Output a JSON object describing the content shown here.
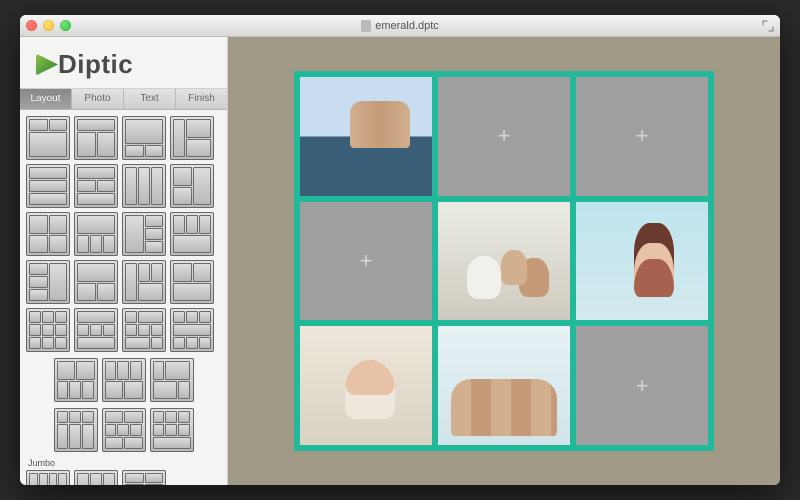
{
  "window": {
    "title": "emerald.dptc"
  },
  "app": {
    "name": "Diptic",
    "logo_letter": "D"
  },
  "tabs": [
    {
      "id": "layout",
      "label": "Layout",
      "active": true
    },
    {
      "id": "photo",
      "label": "Photo",
      "active": false
    },
    {
      "id": "text",
      "label": "Text",
      "active": false
    },
    {
      "id": "finish",
      "label": "Finish",
      "active": false
    }
  ],
  "sidebar": {
    "section2_label": "Jumbo"
  },
  "collage": {
    "border_color": "#22b89a",
    "rows": 3,
    "cols": 3,
    "slots": [
      {
        "index": 0,
        "filled": true,
        "photo": "a"
      },
      {
        "index": 1,
        "filled": false
      },
      {
        "index": 2,
        "filled": false
      },
      {
        "index": 3,
        "filled": false
      },
      {
        "index": 4,
        "filled": true,
        "photo": "b"
      },
      {
        "index": 5,
        "filled": true,
        "photo": "c"
      },
      {
        "index": 6,
        "filled": true,
        "photo": "d"
      },
      {
        "index": 7,
        "filled": true,
        "photo": "e"
      },
      {
        "index": 8,
        "filled": false
      }
    ],
    "placeholder_glyph": "+"
  }
}
